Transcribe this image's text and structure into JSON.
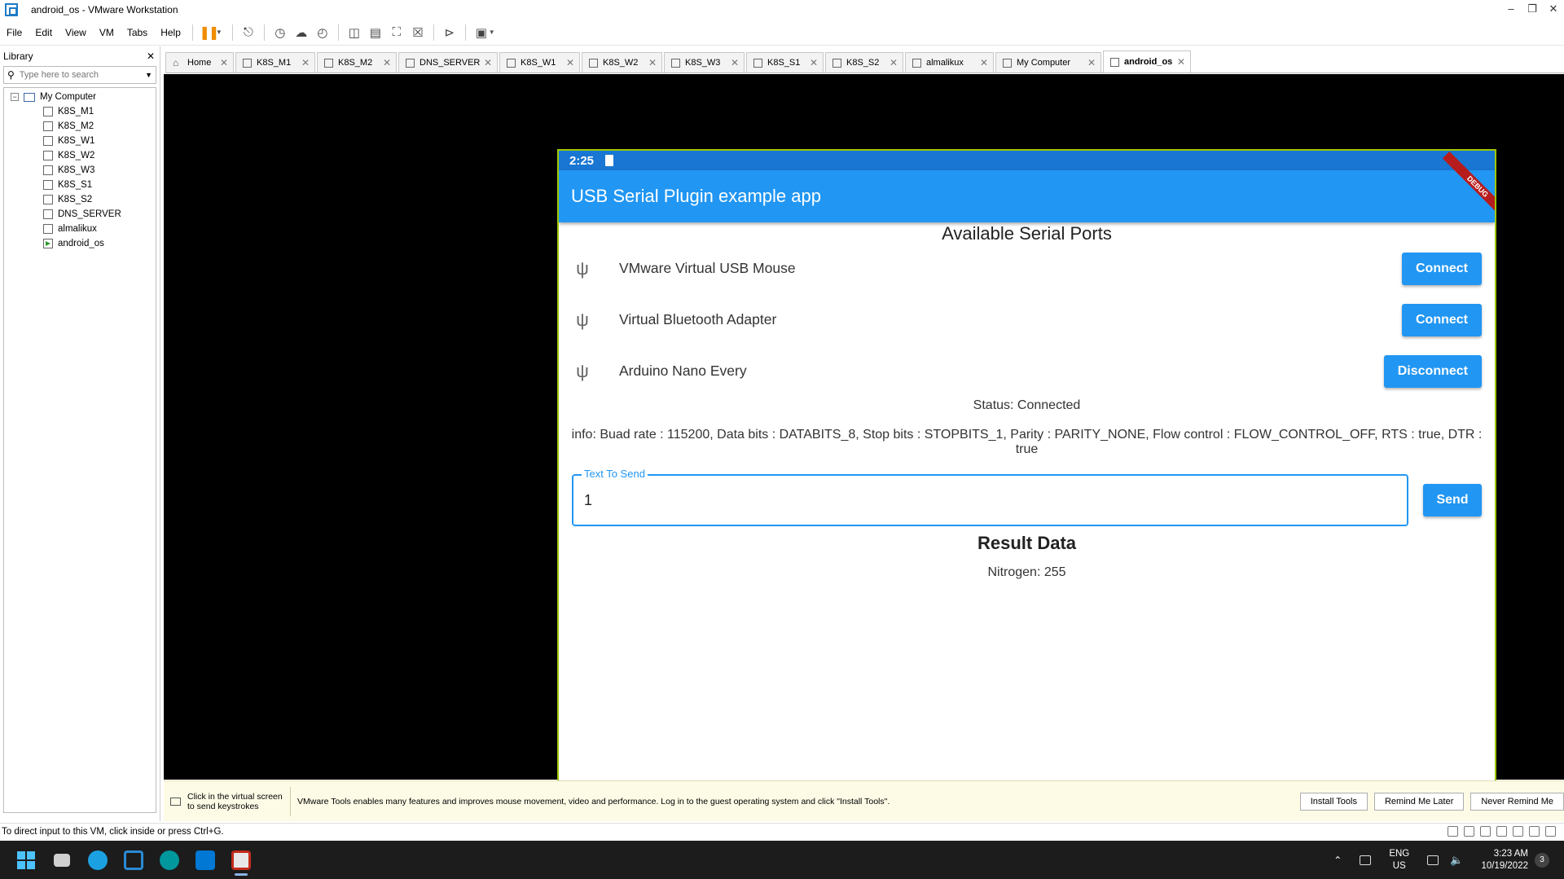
{
  "window": {
    "title": "android_os - VMware Workstation"
  },
  "menu": [
    "File",
    "Edit",
    "View",
    "VM",
    "Tabs",
    "Help"
  ],
  "library": {
    "header": "Library",
    "search_placeholder": "Type here to search",
    "root": "My Computer",
    "vms": [
      "K8S_M1",
      "K8S_M2",
      "K8S_W1",
      "K8S_W2",
      "K8S_W3",
      "K8S_S1",
      "K8S_S2",
      "DNS_SERVER",
      "almalikux",
      "android_os"
    ]
  },
  "tabs": [
    {
      "label": "Home"
    },
    {
      "label": "K8S_M1"
    },
    {
      "label": "K8S_M2"
    },
    {
      "label": "DNS_SERVER"
    },
    {
      "label": "K8S_W1"
    },
    {
      "label": "K8S_W2"
    },
    {
      "label": "K8S_W3"
    },
    {
      "label": "K8S_S1"
    },
    {
      "label": "K8S_S2"
    },
    {
      "label": "almalikux"
    },
    {
      "label": "My Computer"
    },
    {
      "label": "android_os"
    }
  ],
  "android": {
    "time": "2:25",
    "app_title": "USB Serial Plugin example app",
    "debug_banner": "DEBUG",
    "ports_title": "Available Serial Ports",
    "ports": [
      {
        "name": "VMware Virtual USB Mouse",
        "action": "Connect"
      },
      {
        "name": "Virtual Bluetooth Adapter",
        "action": "Connect"
      },
      {
        "name": "Arduino Nano Every",
        "action": "Disconnect"
      }
    ],
    "status": "Status: Connected",
    "info": "info: Buad rate : 115200, Data bits : DATABITS_8, Stop bits : STOPBITS_1, Parity : PARITY_NONE, Flow control : FLOW_CONTROL_OFF, RTS : true, DTR : true",
    "text_field_label": "Text To Send",
    "text_field_value": "1",
    "send_label": "Send",
    "result_title": "Result Data",
    "result_value": "Nitrogen: 255"
  },
  "notification": {
    "click_hint": "Click in the virtual screen to send keystrokes",
    "message": "VMware Tools enables many features and improves mouse movement, video and performance. Log in to the guest operating system and click \"Install Tools\".",
    "install_label": "Install Tools",
    "remind_label": "Remind Me Later",
    "never_label": "Never Remind Me"
  },
  "status_bar": {
    "text": "To direct input to this VM, click inside or press Ctrl+G."
  },
  "taskbar": {
    "lang_top": "ENG",
    "lang_bottom": "US",
    "time": "3:23 AM",
    "date": "10/19/2022",
    "notif_count": "3"
  }
}
